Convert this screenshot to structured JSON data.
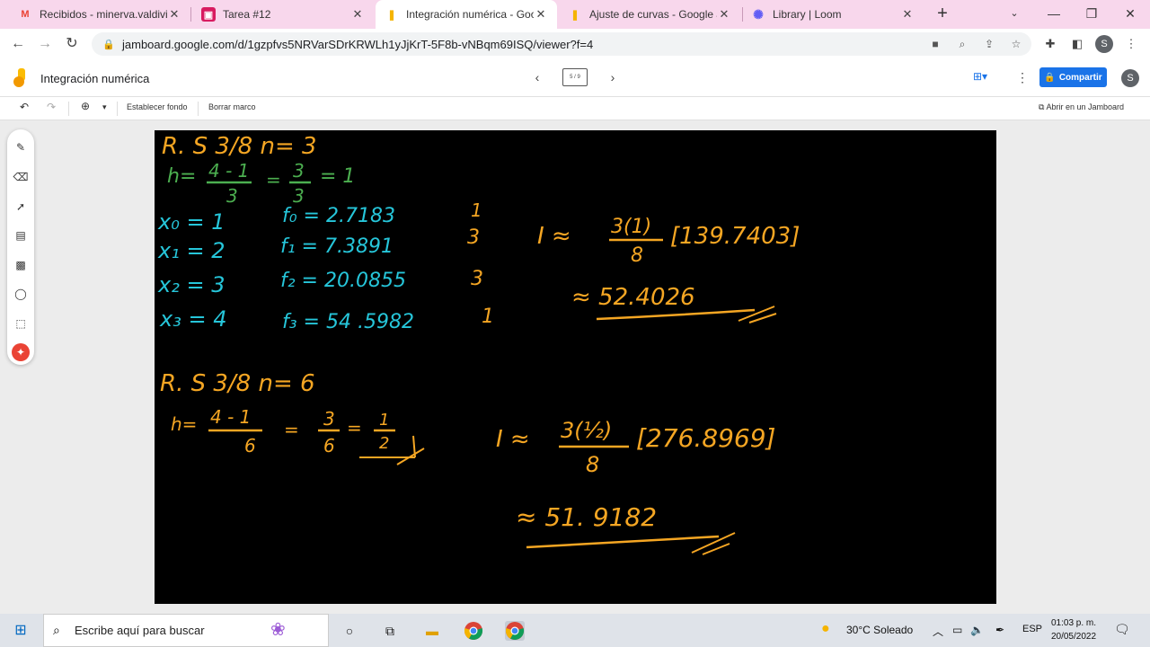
{
  "browser": {
    "tabs": [
      {
        "label": "Recibidos - minerva.valdivia@",
        "icon": "gmail-icon"
      },
      {
        "label": "Tarea #12",
        "icon": "classroom-icon"
      },
      {
        "label": "Integración numérica - Goog",
        "icon": "jamboard-icon",
        "active": true
      },
      {
        "label": "Ajuste de curvas - Google Ja",
        "icon": "jamboard-icon"
      },
      {
        "label": "Library | Loom",
        "icon": "loom-icon"
      }
    ],
    "url": "jamboard.google.com/d/1gzpfvs5NRVarSDrKRWLh1yJjKrT-5F8b-vNBqm69ISQ/viewer?f=4",
    "profile_initial": "S"
  },
  "app": {
    "title": "Integración numérica",
    "frame_indicator": "5 / 9",
    "share_label": "Compartir",
    "profile_initial": "S",
    "accent": "#1a73e8"
  },
  "toolbar": {
    "set_background": "Establecer fondo",
    "clear_frame": "Borrar marco",
    "open_in_jamboard": "Abrir en un Jamboard"
  },
  "board": {
    "background": "#000000",
    "ink_colors": {
      "orange": "#f5a623",
      "green": "#4caf50",
      "cyan": "#26c6da"
    },
    "block1": {
      "heading": "R. S 3/8   n= 3",
      "h_label": "h=",
      "h_num": "4 - 1",
      "h_den": "3",
      "h_eq": "=",
      "h_num2": "3",
      "h_den2": "3",
      "h_res": "= 1",
      "x_values": [
        "x₀ = 1",
        "x₁ = 2",
        "x₂ = 3",
        "x₃ = 4"
      ],
      "f_values": [
        "f₀ = 2.7183",
        "f₁ = 7.3891",
        "f₂ = 20.0855",
        "f₃ = 54 .5982"
      ],
      "weights": [
        "1",
        "3",
        "3",
        "1"
      ],
      "integral_label": "I ≈",
      "integral_num": "3(1)",
      "integral_den": "8",
      "integral_bracket": "[139.7403]",
      "result": "≈ 52.4026"
    },
    "block2": {
      "heading": "R. S 3/8   n= 6",
      "h_label": "h=",
      "h_num": "4 - 1",
      "h_den": "6",
      "h_eq": "=",
      "h_num2": "3",
      "h_den2": "6",
      "h_eq2": "=",
      "h_num3": "1",
      "h_den3": "2",
      "integral_label": "I ≈",
      "integral_num": "3(½)",
      "integral_den": "8",
      "integral_bracket": "[276.8969]",
      "result": "≈ 51. 9182"
    }
  },
  "tools": [
    "pen-icon",
    "eraser-icon",
    "select-icon",
    "sticky-note-icon",
    "image-icon",
    "shape-icon",
    "text-box-icon",
    "laser-icon"
  ],
  "taskbar": {
    "search_placeholder": "Escribe aquí para buscar",
    "weather": "30°C  Soleado",
    "lang": "ESP",
    "time": "01:03 p. m.",
    "date": "20/05/2022"
  }
}
